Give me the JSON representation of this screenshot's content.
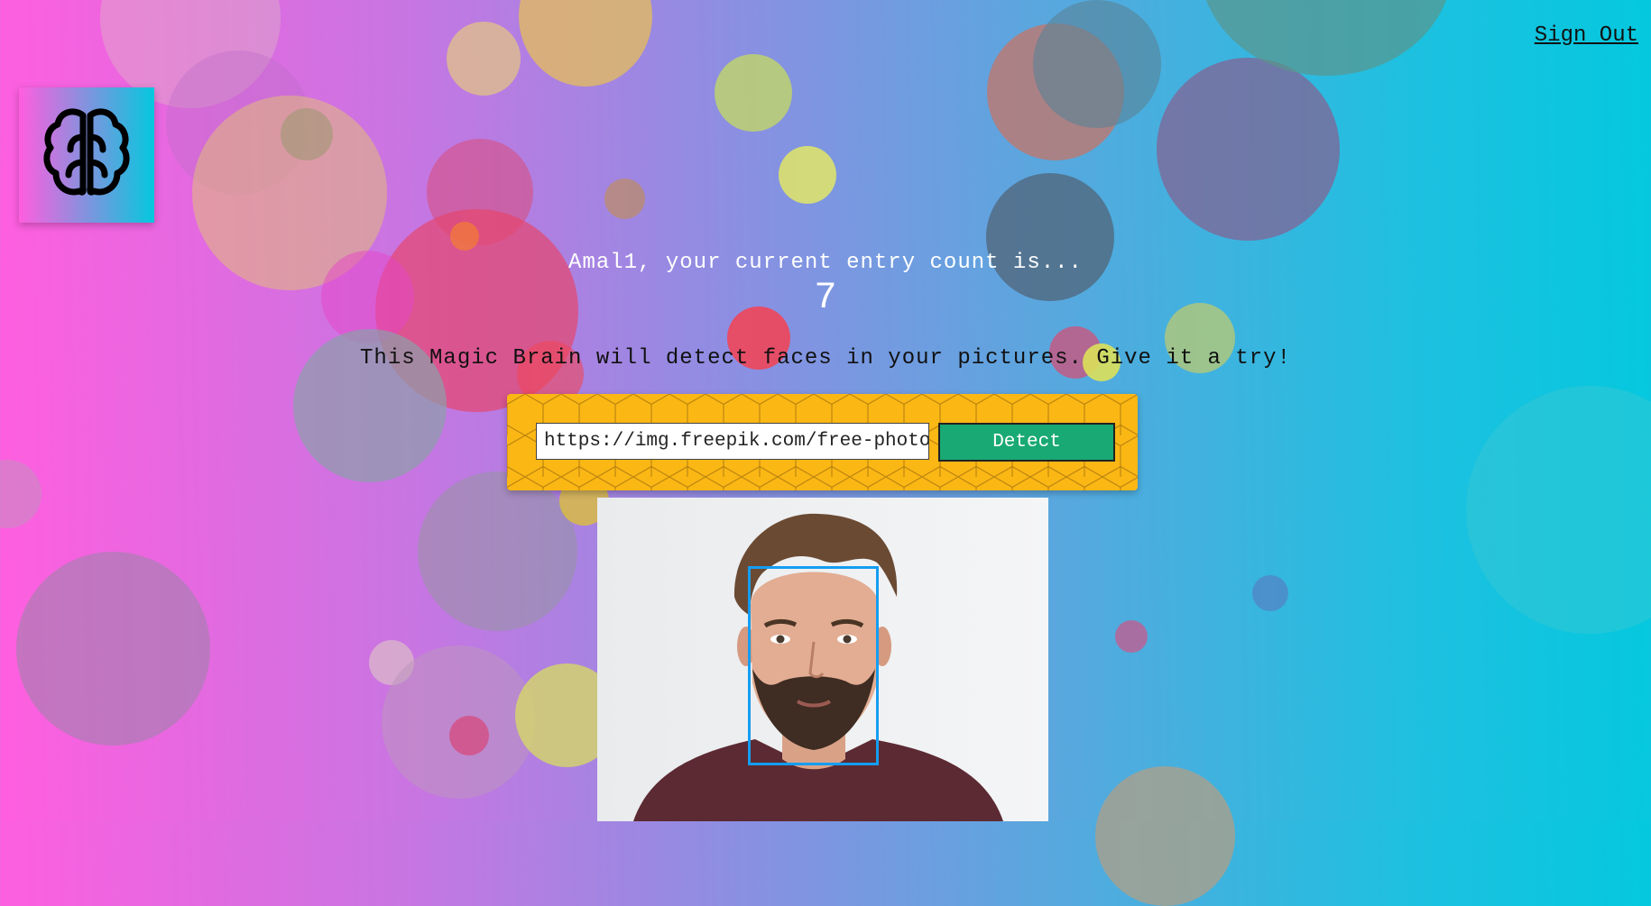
{
  "nav": {
    "sign_out_label": "Sign Out"
  },
  "logo": {
    "icon": "brain-icon"
  },
  "rank": {
    "message": "Amal1, your current entry count is...",
    "count": "7"
  },
  "tagline": "This Magic Brain will detect faces in your pictures. Give it a try!",
  "form": {
    "url_value": "https://img.freepik.com/free-photo/p",
    "detect_label": "Detect"
  },
  "colors": {
    "gradient_left": "#ff5edf",
    "gradient_right": "#04c8de",
    "panel": "#fbb714",
    "detect_button": "#19a974",
    "face_box": "#149df2"
  }
}
